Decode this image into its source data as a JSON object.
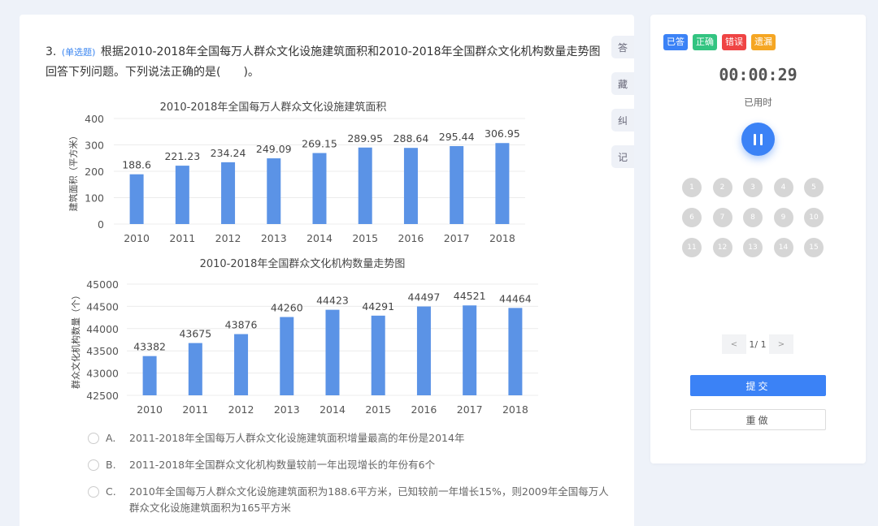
{
  "question": {
    "number": "3.",
    "type": "(单选题)",
    "text": "根据2010-2018年全国每万人群众文化设施建筑面积和2010-2018年全国群众文化机构数量走势图回答下列问题。下列说法正确的是(　　)。"
  },
  "side_tools": [
    "答",
    "藏",
    "纠",
    "记"
  ],
  "chart_data": [
    {
      "type": "bar",
      "title": "2010-2018年全国每万人群众文化设施建筑面积",
      "ylabel": "建筑面积（平方米）",
      "categories": [
        "2010",
        "2011",
        "2012",
        "2013",
        "2014",
        "2015",
        "2016",
        "2017",
        "2018"
      ],
      "values": [
        188.6,
        221.23,
        234.24,
        249.09,
        269.15,
        289.95,
        288.64,
        295.44,
        306.95
      ],
      "value_labels": [
        "188.6",
        "221.23",
        "234.24",
        "249.09",
        "269.15",
        "289.95",
        "288.64",
        "295.44",
        "306.95"
      ],
      "yticks": [
        "0",
        "100",
        "200",
        "300",
        "400"
      ],
      "ylim": [
        0,
        400
      ],
      "color": "#5b93e6",
      "grid": true
    },
    {
      "type": "bar",
      "title": "2010-2018年全国群众文化机构数量走势图",
      "ylabel": "群众文化机构数量（个）",
      "categories": [
        "2010",
        "2011",
        "2012",
        "2013",
        "2014",
        "2015",
        "2016",
        "2017",
        "2018"
      ],
      "values": [
        43382,
        43675,
        43876,
        44260,
        44423,
        44291,
        44497,
        44521,
        44464
      ],
      "value_labels": [
        "43382",
        "43675",
        "43876",
        "44260",
        "44423",
        "44291",
        "44497",
        "44521",
        "44464"
      ],
      "yticks": [
        "42500",
        "43000",
        "43500",
        "44000",
        "44500",
        "45000"
      ],
      "ylim": [
        42500,
        45000
      ],
      "color": "#5b93e6",
      "grid": true
    }
  ],
  "options": [
    {
      "letter": "A.",
      "text": "2011-2018年全国每万人群众文化设施建筑面积增量最高的年份是2014年"
    },
    {
      "letter": "B.",
      "text": "2011-2018年全国群众文化机构数量较前一年出现增长的年份有6个"
    },
    {
      "letter": "C.",
      "text": "2010年全国每万人群众文化设施建筑面积为188.6平方米，已知较前一年增长15%，则2009年全国每万人群众文化设施建筑面积为165平方米"
    }
  ],
  "panel": {
    "legend": [
      {
        "label": "已答",
        "color": "#3b82f6"
      },
      {
        "label": "正确",
        "color": "#33c481"
      },
      {
        "label": "错误",
        "color": "#ef4444"
      },
      {
        "label": "遗漏",
        "color": "#f5a623"
      }
    ],
    "timer": "00:00:29",
    "timer_label": "已用时",
    "questions": [
      "1",
      "2",
      "3",
      "4",
      "5",
      "6",
      "7",
      "8",
      "9",
      "10",
      "11",
      "12",
      "13",
      "14",
      "15"
    ],
    "pager": {
      "prev": "<",
      "info": "1/ 1",
      "next": ">"
    },
    "submit_label": "提交",
    "redo_label": "重做"
  }
}
